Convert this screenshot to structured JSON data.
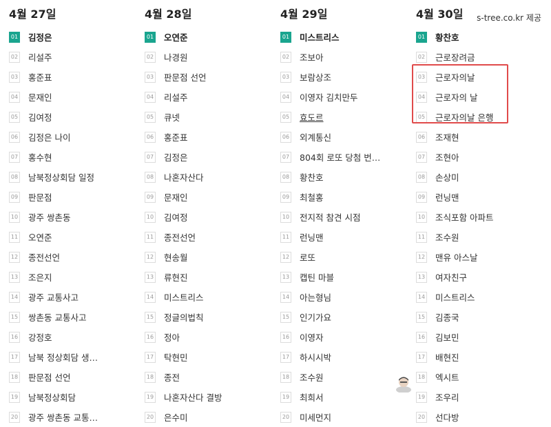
{
  "credit": "s-tree.co.kr 제공",
  "columns": [
    {
      "date": "4월 27일",
      "items": [
        {
          "rank": "01",
          "keyword": "김정은"
        },
        {
          "rank": "02",
          "keyword": "리설주"
        },
        {
          "rank": "03",
          "keyword": "홍준표"
        },
        {
          "rank": "04",
          "keyword": "문재인"
        },
        {
          "rank": "05",
          "keyword": "김여정"
        },
        {
          "rank": "06",
          "keyword": "김정은 나이"
        },
        {
          "rank": "07",
          "keyword": "홍수현"
        },
        {
          "rank": "08",
          "keyword": "남북정상회담 일정"
        },
        {
          "rank": "09",
          "keyword": "판문점"
        },
        {
          "rank": "10",
          "keyword": "광주 쌍촌동"
        },
        {
          "rank": "11",
          "keyword": "오연준"
        },
        {
          "rank": "12",
          "keyword": "종전선언"
        },
        {
          "rank": "13",
          "keyword": "조은지"
        },
        {
          "rank": "14",
          "keyword": "광주 교통사고"
        },
        {
          "rank": "15",
          "keyword": "쌍촌동 교통사고"
        },
        {
          "rank": "16",
          "keyword": "강정호"
        },
        {
          "rank": "17",
          "keyword": "남북 정상회담 생…"
        },
        {
          "rank": "18",
          "keyword": "판문점 선언"
        },
        {
          "rank": "19",
          "keyword": "남북정상회담"
        },
        {
          "rank": "20",
          "keyword": "광주 쌍촌동 교통…"
        }
      ]
    },
    {
      "date": "4월 28일",
      "items": [
        {
          "rank": "01",
          "keyword": "오연준"
        },
        {
          "rank": "02",
          "keyword": "나경원"
        },
        {
          "rank": "03",
          "keyword": "판문점 선언"
        },
        {
          "rank": "04",
          "keyword": "리설주"
        },
        {
          "rank": "05",
          "keyword": "큐넷"
        },
        {
          "rank": "06",
          "keyword": "홍준표"
        },
        {
          "rank": "07",
          "keyword": "김정은"
        },
        {
          "rank": "08",
          "keyword": "나혼자산다"
        },
        {
          "rank": "09",
          "keyword": "문재인"
        },
        {
          "rank": "10",
          "keyword": "김여정"
        },
        {
          "rank": "11",
          "keyword": "종전선언"
        },
        {
          "rank": "12",
          "keyword": "현송월"
        },
        {
          "rank": "13",
          "keyword": "류현진"
        },
        {
          "rank": "14",
          "keyword": "미스트리스"
        },
        {
          "rank": "15",
          "keyword": "정글의법칙"
        },
        {
          "rank": "16",
          "keyword": "정아"
        },
        {
          "rank": "17",
          "keyword": "탁현민"
        },
        {
          "rank": "18",
          "keyword": "종전"
        },
        {
          "rank": "19",
          "keyword": "나혼자산다 결방"
        },
        {
          "rank": "20",
          "keyword": "은수미"
        }
      ]
    },
    {
      "date": "4월 29일",
      "items": [
        {
          "rank": "01",
          "keyword": "미스트리스"
        },
        {
          "rank": "02",
          "keyword": "조보아"
        },
        {
          "rank": "03",
          "keyword": "보람상조"
        },
        {
          "rank": "04",
          "keyword": "이영자 김치만두"
        },
        {
          "rank": "05",
          "keyword": "효도르",
          "underlined": true
        },
        {
          "rank": "06",
          "keyword": "외계통신"
        },
        {
          "rank": "07",
          "keyword": "804회 로또 당첨 번…"
        },
        {
          "rank": "08",
          "keyword": "황찬호"
        },
        {
          "rank": "09",
          "keyword": "최철홍"
        },
        {
          "rank": "10",
          "keyword": "전지적 참견 시점"
        },
        {
          "rank": "11",
          "keyword": "런닝맨"
        },
        {
          "rank": "12",
          "keyword": "로또"
        },
        {
          "rank": "13",
          "keyword": "캡틴 마블"
        },
        {
          "rank": "14",
          "keyword": "아는형님"
        },
        {
          "rank": "15",
          "keyword": "인기가요"
        },
        {
          "rank": "16",
          "keyword": "이영자"
        },
        {
          "rank": "17",
          "keyword": "하시시박"
        },
        {
          "rank": "18",
          "keyword": "조수원"
        },
        {
          "rank": "19",
          "keyword": "최희서"
        },
        {
          "rank": "20",
          "keyword": "미세먼지"
        }
      ]
    },
    {
      "date": "4월 30일",
      "items": [
        {
          "rank": "01",
          "keyword": "황찬호"
        },
        {
          "rank": "02",
          "keyword": "근로장려금"
        },
        {
          "rank": "03",
          "keyword": "근로자의날"
        },
        {
          "rank": "04",
          "keyword": "근로자의 날"
        },
        {
          "rank": "05",
          "keyword": "근로자의날 은행"
        },
        {
          "rank": "06",
          "keyword": "조재현"
        },
        {
          "rank": "07",
          "keyword": "조현아"
        },
        {
          "rank": "08",
          "keyword": "손상미"
        },
        {
          "rank": "09",
          "keyword": "런닝맨"
        },
        {
          "rank": "10",
          "keyword": "조식포함 아파트"
        },
        {
          "rank": "11",
          "keyword": "조수원"
        },
        {
          "rank": "12",
          "keyword": "맨유 아스날"
        },
        {
          "rank": "13",
          "keyword": "여자친구"
        },
        {
          "rank": "14",
          "keyword": "미스트리스"
        },
        {
          "rank": "15",
          "keyword": "김종국"
        },
        {
          "rank": "16",
          "keyword": "김보민"
        },
        {
          "rank": "17",
          "keyword": "배현진"
        },
        {
          "rank": "18",
          "keyword": "엑시트"
        },
        {
          "rank": "19",
          "keyword": "조우리"
        },
        {
          "rank": "20",
          "keyword": "선다방"
        }
      ]
    }
  ],
  "colors": {
    "top_rank": "#1aa58f",
    "highlight": "#e04a4a"
  }
}
